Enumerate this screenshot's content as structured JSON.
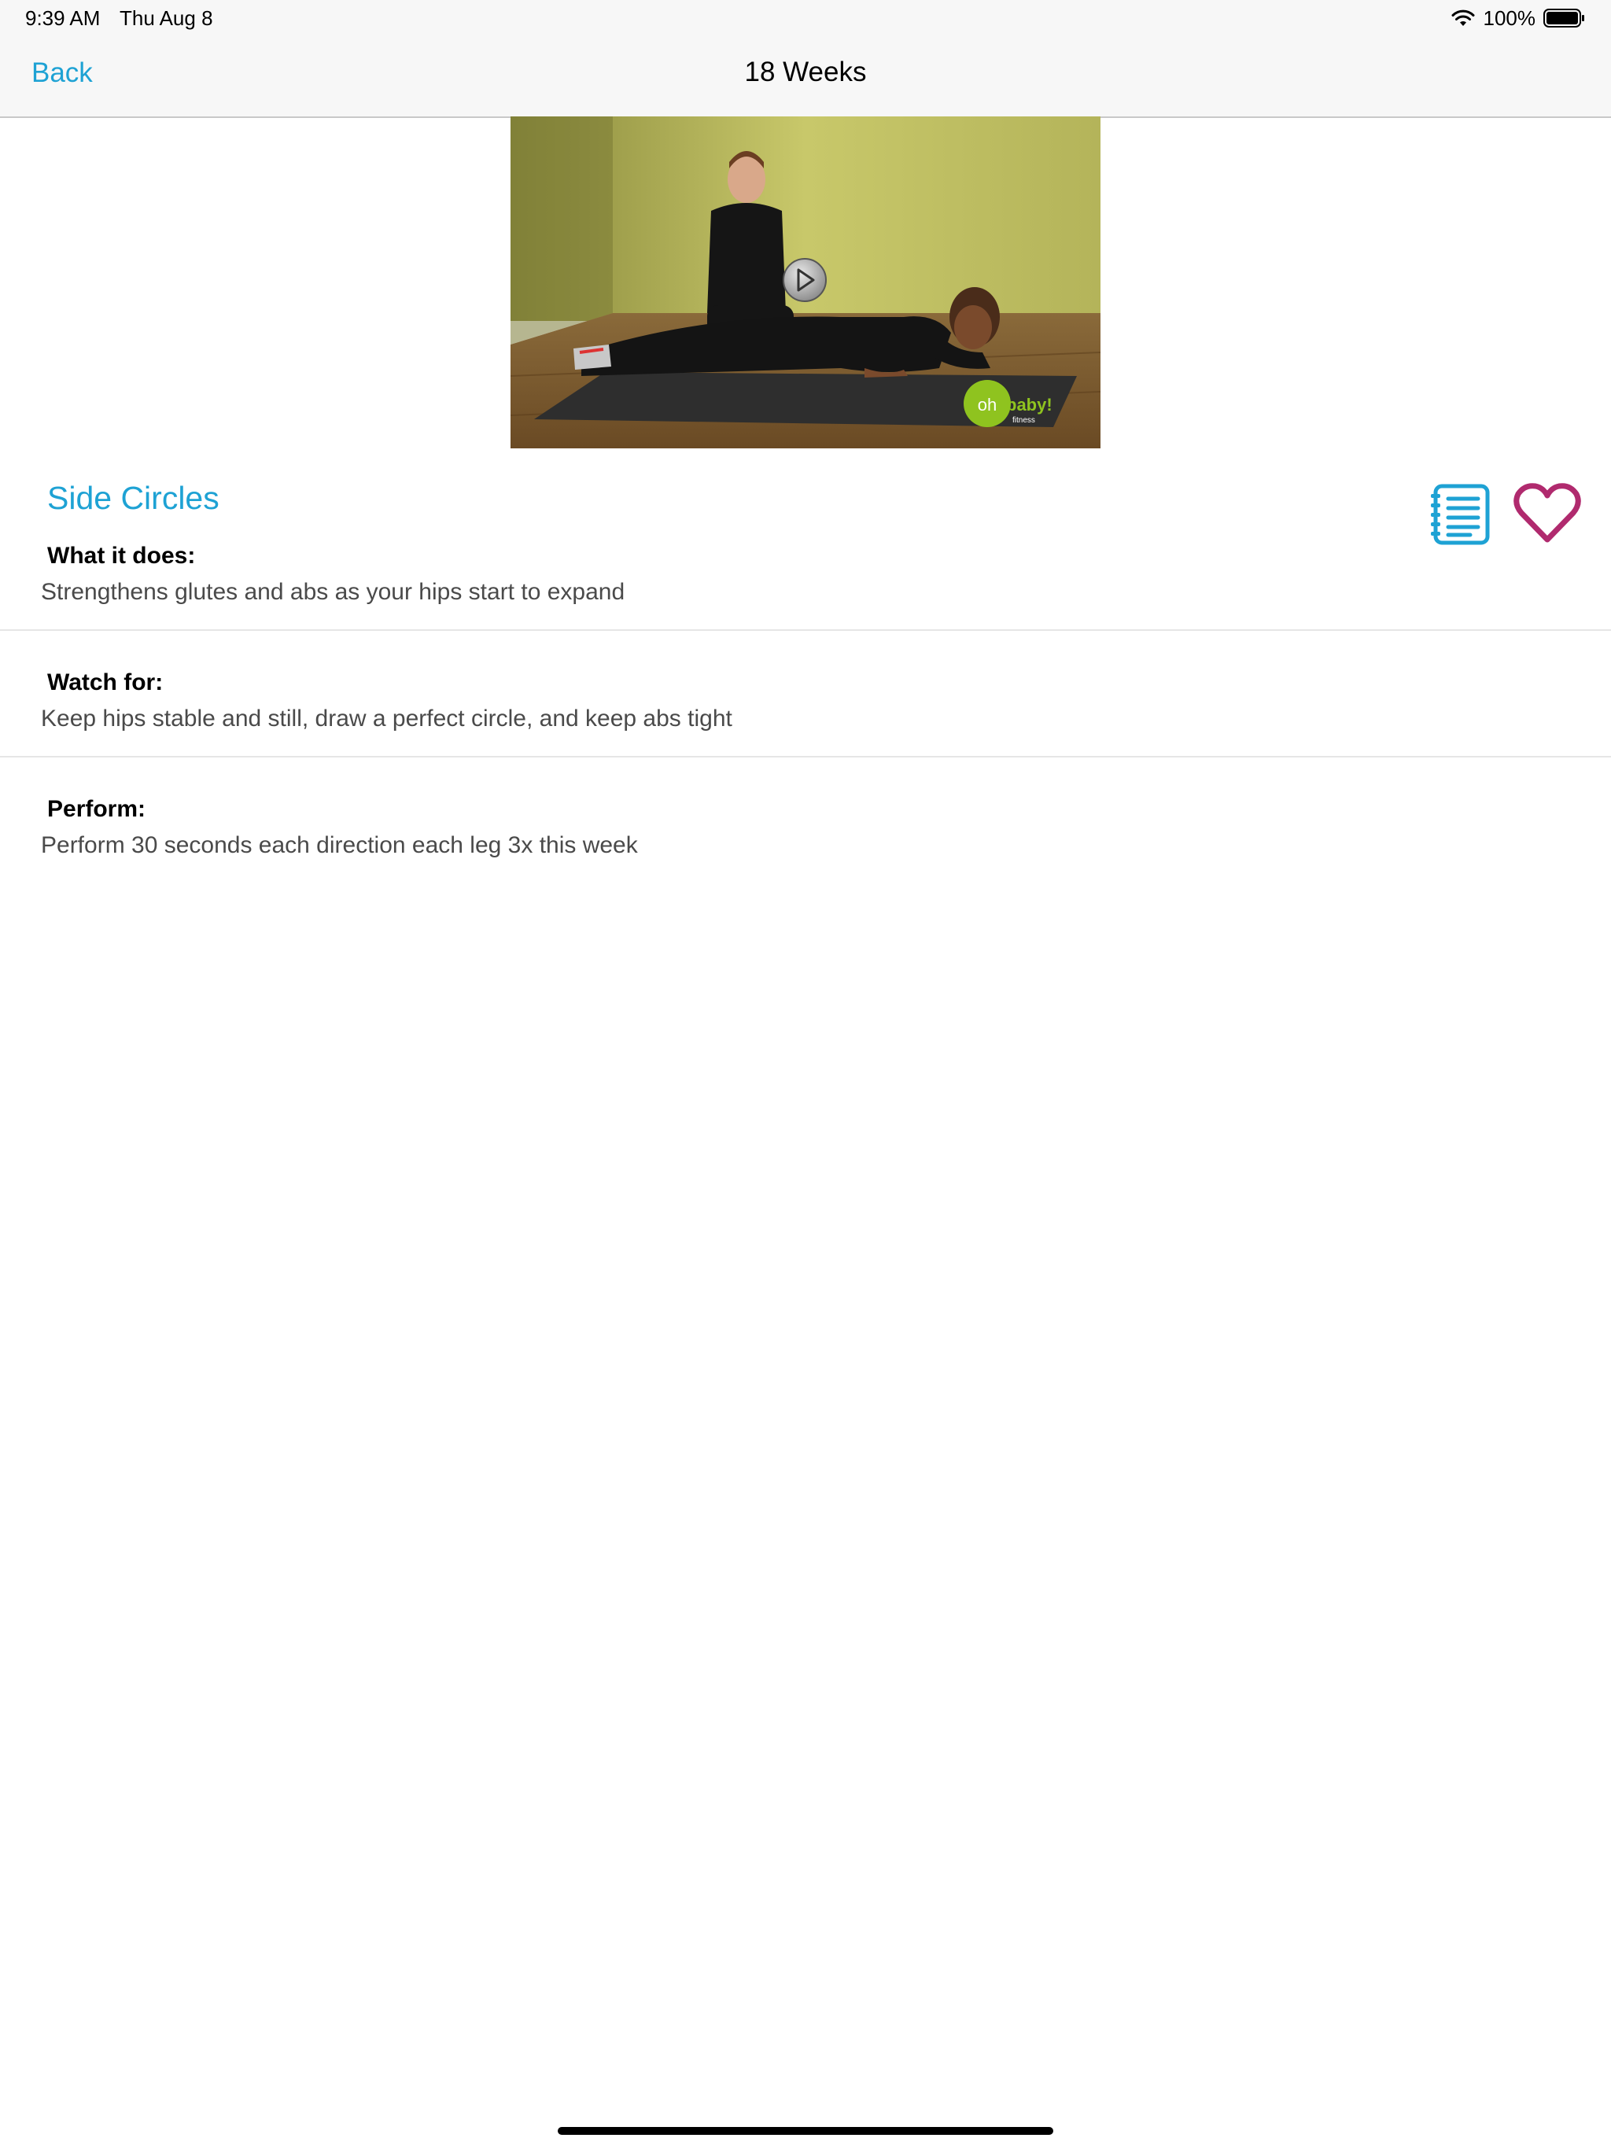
{
  "status_bar": {
    "time": "9:39 AM",
    "date": "Thu Aug 8",
    "battery_percent": "100%",
    "icons": [
      "wifi-icon",
      "battery-icon"
    ]
  },
  "nav": {
    "back_label": "Back",
    "title": "18 Weeks"
  },
  "video": {
    "icon": "play-icon",
    "logo_word_1": "oh",
    "logo_word_2": "baby!",
    "logo_word_3": "fitness"
  },
  "exercise": {
    "title": "Side Circles",
    "actions": [
      "notes-icon",
      "heart-icon"
    ],
    "sections": [
      {
        "heading": "What it does:",
        "body": "Strengthens glutes and abs as your hips start to expand"
      },
      {
        "heading": "Watch for:",
        "body": "Keep hips stable and still, draw a perfect circle, and keep abs tight"
      },
      {
        "heading": "Perform:",
        "body": "Perform 30 seconds each direction each leg 3x this week"
      }
    ]
  },
  "colors": {
    "accent": "#1ea2d4",
    "heart": "#b02a6e",
    "logo_green": "#8fc31f"
  }
}
